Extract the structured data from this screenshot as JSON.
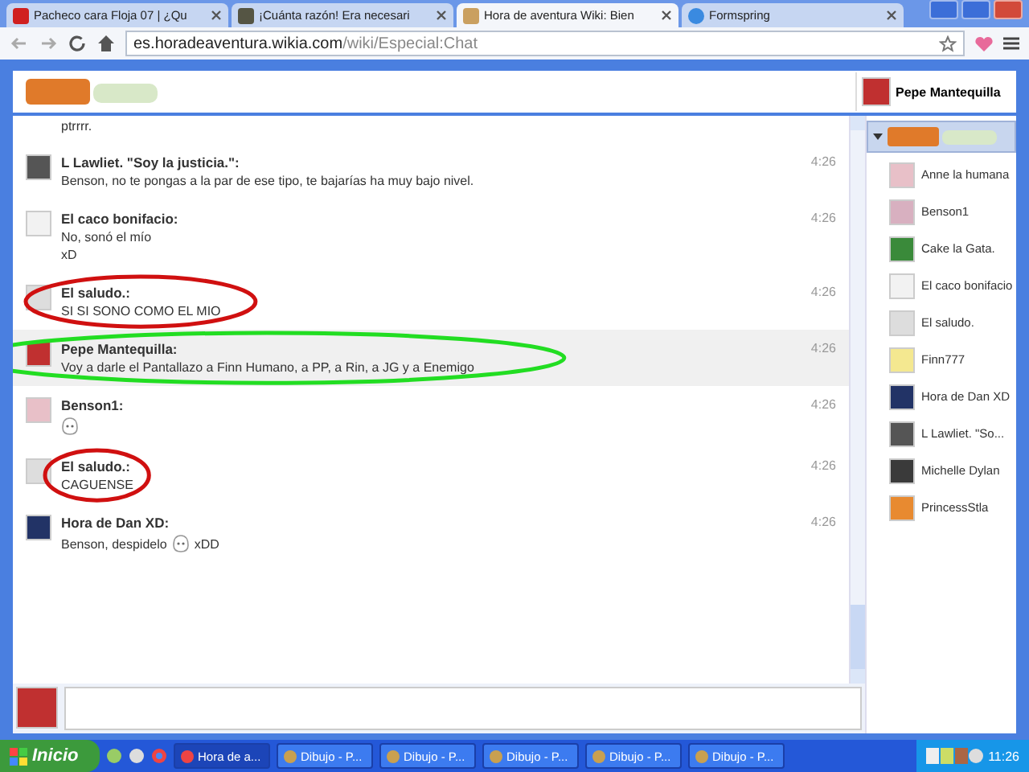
{
  "browser": {
    "tabs": [
      {
        "label": "Pacheco cara Floja 07 | ¿Qu",
        "kind": "video",
        "selected": false
      },
      {
        "label": "¡Cuánta razón! Era necesari",
        "kind": "picture",
        "selected": false
      },
      {
        "label": "Hora de aventura Wiki: Bien",
        "kind": "cat",
        "selected": true
      },
      {
        "label": "Formspring",
        "kind": "question",
        "selected": false
      }
    ],
    "address": {
      "host": "es.horadeaventura.wikia.com",
      "path": "/wiki/Especial:Chat"
    }
  },
  "chat": {
    "current_user": "Pepe Mantequilla",
    "messages": [
      {
        "lines": [
          [
            {
              "kind": "text",
              "text": "ptrrrr."
            }
          ]
        ],
        "highlighted": false
      },
      {
        "name": "L Lawliet. \"Soy la justicia.\":",
        "lines": [
          [
            {
              "kind": "text",
              "text": "Benson, no te pongas a la par de ese tipo, te bajarías ha muy bajo nivel."
            }
          ]
        ],
        "time": "4:26",
        "highlighted": false,
        "color": "#555555"
      },
      {
        "name": "El caco bonifacio:",
        "lines": [
          [
            {
              "kind": "text",
              "text": "No, sonó el mío"
            }
          ],
          [
            {
              "kind": "text",
              "text": "xD"
            }
          ]
        ],
        "time": "4:26",
        "highlighted": false,
        "color": "#f2f2f2"
      },
      {
        "name": "El saludo.:",
        "lines": [
          [
            {
              "kind": "text",
              "text": "SI SI SONO COMO EL MIO"
            }
          ]
        ],
        "time": "4:26",
        "highlighted": false,
        "color": "#dddddd",
        "annotation": {
          "color": "#d01010"
        }
      },
      {
        "name": "Pepe Mantequilla:",
        "lines": [
          [
            {
              "kind": "text",
              "text": "Voy a darle el Pantallazo a Finn Humano, a PP, a Rin, a JG y a Enemigo"
            }
          ]
        ],
        "time": "4:26",
        "highlighted": true,
        "color": "#c03030",
        "annotation": {
          "color": "#22dd22"
        }
      },
      {
        "name": "Benson1:",
        "lines": [
          [
            {
              "kind": "emote"
            }
          ]
        ],
        "time": "4:26",
        "highlighted": false,
        "color": "#e8c0c8"
      },
      {
        "name": "El saludo.:",
        "lines": [
          [
            {
              "kind": "text",
              "text": "CAGUENSE"
            }
          ]
        ],
        "time": "4:26",
        "highlighted": false,
        "color": "#dddddd",
        "annotation": {
          "color": "#d01010"
        }
      },
      {
        "name": "Hora de Dan XD:",
        "lines": [
          [
            {
              "kind": "text",
              "text": "Benson, despidelo"
            },
            {
              "kind": "emote"
            },
            {
              "kind": "text",
              "text": "xDD"
            }
          ]
        ],
        "time": "4:26",
        "highlighted": false,
        "color": "#223366"
      }
    ],
    "users": [
      {
        "name": "Anne la humana",
        "color": "#e8c0c8"
      },
      {
        "name": "Benson1",
        "color": "#d8b0c0"
      },
      {
        "name": "Cake la Gata.",
        "color": "#3a8a3a"
      },
      {
        "name": "El caco bonifacio",
        "color": "#f2f2f2"
      },
      {
        "name": "El saludo.",
        "color": "#dddddd"
      },
      {
        "name": "Finn777",
        "color": "#f4e890"
      },
      {
        "name": "Hora de Dan XD",
        "color": "#223366"
      },
      {
        "name": "L Lawliet. \"So...",
        "color": "#555555"
      },
      {
        "name": "Michelle Dylan",
        "color": "#3a3a3a"
      },
      {
        "name": "PrincessStla",
        "color": "#e88a30"
      }
    ]
  },
  "taskbar": {
    "start": "Inicio",
    "tasks": [
      {
        "label": "Hora de a...",
        "kind": "browser",
        "selected": true
      },
      {
        "label": "Dibujo - P...",
        "kind": "paint",
        "selected": false
      },
      {
        "label": "Dibujo - P...",
        "kind": "paint",
        "selected": false
      },
      {
        "label": "Dibujo - P...",
        "kind": "paint",
        "selected": false
      },
      {
        "label": "Dibujo - P...",
        "kind": "paint",
        "selected": false
      },
      {
        "label": "Dibujo - P...",
        "kind": "paint",
        "selected": false
      }
    ],
    "clock": "11:26"
  }
}
